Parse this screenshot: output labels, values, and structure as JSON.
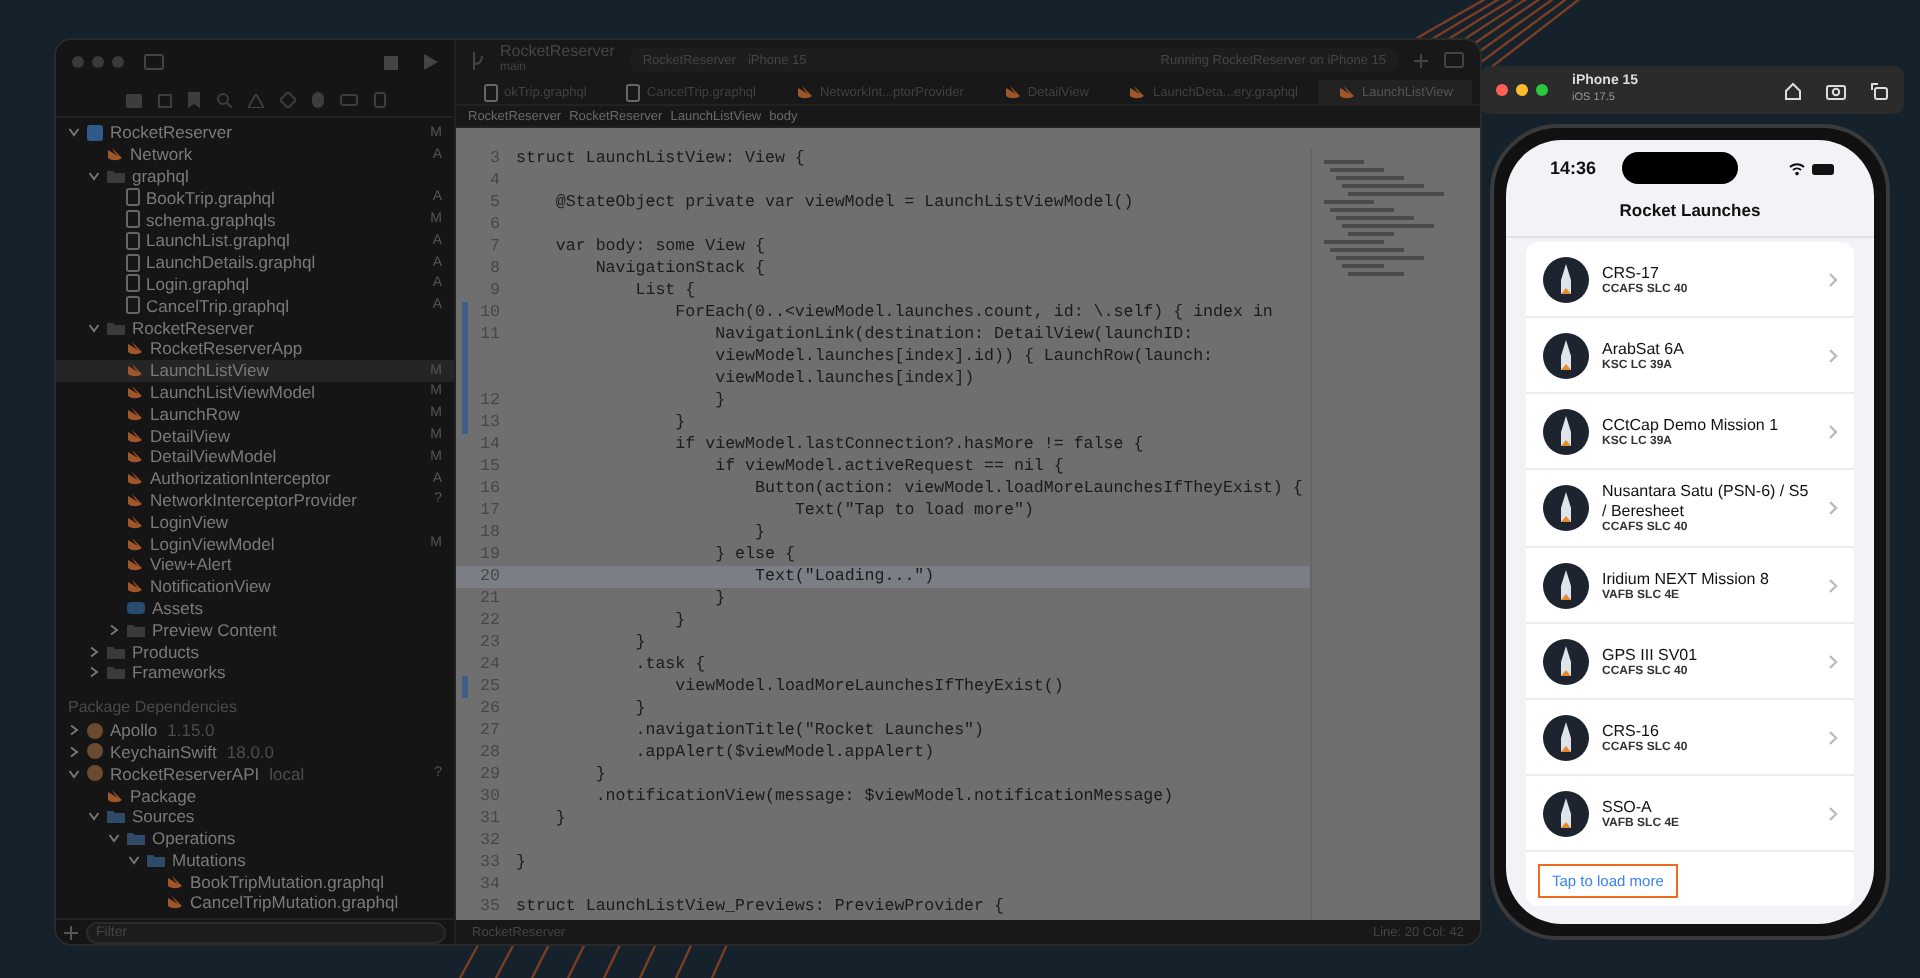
{
  "xcode": {
    "navigator": {
      "tree": [
        {
          "label": "RocketReserver",
          "kind": "project",
          "badge": "M",
          "selected": false,
          "expanded": true,
          "children": [
            {
              "label": "Network",
              "kind": "swift",
              "badge": "A",
              "selected": false
            },
            {
              "label": "graphql",
              "kind": "folder",
              "selected": false,
              "expanded": true,
              "children": [
                {
                  "label": "BookTrip.graphql",
                  "kind": "file",
                  "badge": "A",
                  "selected": false
                },
                {
                  "label": "schema.graphqls",
                  "kind": "file",
                  "badge": "M",
                  "selected": false
                },
                {
                  "label": "LaunchList.graphql",
                  "kind": "file",
                  "badge": "A",
                  "selected": false
                },
                {
                  "label": "LaunchDetails.graphql",
                  "kind": "file",
                  "badge": "A",
                  "selected": false
                },
                {
                  "label": "Login.graphql",
                  "kind": "file",
                  "badge": "A",
                  "selected": false
                },
                {
                  "label": "CancelTrip.graphql",
                  "kind": "file",
                  "badge": "A",
                  "selected": false
                }
              ]
            },
            {
              "label": "RocketReserver",
              "kind": "folder",
              "selected": false,
              "expanded": true,
              "children": [
                {
                  "label": "RocketReserverApp",
                  "kind": "swift",
                  "selected": false
                },
                {
                  "label": "LaunchListView",
                  "kind": "swift",
                  "badge": "M",
                  "selected": true
                },
                {
                  "label": "LaunchListViewModel",
                  "kind": "swift",
                  "badge": "M",
                  "selected": false
                },
                {
                  "label": "LaunchRow",
                  "kind": "swift",
                  "badge": "M",
                  "selected": false
                },
                {
                  "label": "DetailView",
                  "kind": "swift",
                  "badge": "M",
                  "selected": false
                },
                {
                  "label": "DetailViewModel",
                  "kind": "swift",
                  "badge": "M",
                  "selected": false
                },
                {
                  "label": "AuthorizationInterceptor",
                  "kind": "swift",
                  "badge": "A",
                  "selected": false
                },
                {
                  "label": "NetworkInterceptorProvider",
                  "kind": "swift",
                  "badge": "?",
                  "selected": false
                },
                {
                  "label": "LoginView",
                  "kind": "swift",
                  "selected": false
                },
                {
                  "label": "LoginViewModel",
                  "kind": "swift",
                  "badge": "M",
                  "selected": false
                },
                {
                  "label": "View+Alert",
                  "kind": "swift",
                  "selected": false
                },
                {
                  "label": "NotificationView",
                  "kind": "swift",
                  "selected": false
                },
                {
                  "label": "Assets",
                  "kind": "assets",
                  "selected": false
                },
                {
                  "label": "Preview Content",
                  "kind": "folder",
                  "selected": false,
                  "expanded": false
                }
              ]
            },
            {
              "label": "Products",
              "kind": "folder",
              "selected": false,
              "expanded": false
            },
            {
              "label": "Frameworks",
              "kind": "folder",
              "selected": false,
              "expanded": false
            }
          ]
        }
      ],
      "packages_header": "Package Dependencies",
      "packages": [
        {
          "label": "Apollo",
          "kind": "package",
          "version": "1.15.0",
          "selected": false,
          "expanded": false
        },
        {
          "label": "KeychainSwift",
          "kind": "package",
          "version": "18.0.0",
          "selected": false,
          "expanded": false
        },
        {
          "label": "RocketReserverAPI",
          "kind": "package",
          "version": "local",
          "badge": "?",
          "selected": false,
          "expanded": true,
          "children": [
            {
              "label": "Package",
              "kind": "swift",
              "selected": false
            },
            {
              "label": "Sources",
              "kind": "blue-folder",
              "selected": false,
              "expanded": true,
              "children": [
                {
                  "label": "Operations",
                  "kind": "blue-folder",
                  "selected": false,
                  "expanded": true,
                  "children": [
                    {
                      "label": "Mutations",
                      "kind": "blue-folder",
                      "selected": false,
                      "expanded": true,
                      "children": [
                        {
                          "label": "BookTripMutation.graphql",
                          "kind": "swift",
                          "selected": false
                        },
                        {
                          "label": "CancelTripMutation.graphql",
                          "kind": "swift",
                          "selected": false
                        }
                      ]
                    }
                  ]
                }
              ]
            }
          ]
        }
      ],
      "filter": {
        "placeholder": "Filter"
      }
    },
    "toolbar": {
      "project": "RocketReserver",
      "branch": "main",
      "scheme": "RocketReserver",
      "device": "iPhone 15",
      "status": "Running RocketReserver on iPhone 15"
    },
    "tabs": [
      {
        "label": "okTrip.graphql",
        "kind": "file",
        "selected": false
      },
      {
        "label": "CancelTrip.graphql",
        "kind": "file",
        "selected": false
      },
      {
        "label": "NetworkInt...ptorProvider",
        "kind": "swift",
        "selected": false
      },
      {
        "label": "DetailView",
        "kind": "swift",
        "selected": false
      },
      {
        "label": "LaunchDeta...ery.graphql",
        "kind": "swift",
        "selected": false
      },
      {
        "label": "LaunchListView",
        "kind": "swift",
        "selected": true
      }
    ],
    "breadcrumb": [
      "RocketReserver",
      "RocketReserver",
      "LaunchListView",
      "body"
    ],
    "code": [
      {
        "n": "3",
        "text": "struct LaunchListView: View {",
        "highlighted": false,
        "changed": false
      },
      {
        "n": "4",
        "highlighted": false,
        "changed": false
      },
      {
        "n": "5",
        "text": "    @StateObject private var viewModel = LaunchListViewModel()",
        "highlighted": false,
        "changed": false
      },
      {
        "n": "6",
        "highlighted": false,
        "changed": false
      },
      {
        "n": "7",
        "text": "    var body: some View {",
        "highlighted": false,
        "changed": false
      },
      {
        "n": "8",
        "text": "        NavigationStack {",
        "highlighted": false,
        "changed": false
      },
      {
        "n": "9",
        "text": "            List {",
        "highlighted": false,
        "changed": false
      },
      {
        "n": "10",
        "text": "                ForEach(0..<viewModel.launches.count, id: \\.self) { index in",
        "highlighted": false,
        "changed": true
      },
      {
        "n": "11",
        "text": "                    NavigationLink(destination: DetailView(launchID:",
        "wrapped": [
          "viewModel.launches[index].id)) { LaunchRow(launch:",
          "viewModel.launches[index])"
        ],
        "highlighted": false,
        "changed": true
      },
      {
        "n": "12",
        "text": "                    }",
        "highlighted": false,
        "changed": true
      },
      {
        "n": "13",
        "text": "                }",
        "highlighted": false,
        "changed": true
      },
      {
        "n": "14",
        "text": "                if viewModel.lastConnection?.hasMore != false {",
        "highlighted": false,
        "changed": false
      },
      {
        "n": "15",
        "text": "                    if viewModel.activeRequest == nil {",
        "highlighted": false,
        "changed": false
      },
      {
        "n": "16",
        "text": "                        Button(action: viewModel.loadMoreLaunchesIfTheyExist) {",
        "highlighted": false,
        "changed": false
      },
      {
        "n": "17",
        "text": "                            Text(\"Tap to load more\")",
        "highlighted": false,
        "changed": false
      },
      {
        "n": "18",
        "text": "                        }",
        "highlighted": false,
        "changed": false
      },
      {
        "n": "19",
        "text": "                    } else {",
        "highlighted": false,
        "changed": false
      },
      {
        "n": "20",
        "text": "                        Text(\"Loading...\")",
        "highlighted": true,
        "changed": false
      },
      {
        "n": "21",
        "text": "                    }",
        "highlighted": false,
        "changed": false
      },
      {
        "n": "22",
        "text": "                }",
        "highlighted": false,
        "changed": false
      },
      {
        "n": "23",
        "text": "            }",
        "highlighted": false,
        "changed": false
      },
      {
        "n": "24",
        "text": "            .task {",
        "highlighted": false,
        "changed": false
      },
      {
        "n": "25",
        "text": "                viewModel.loadMoreLaunchesIfTheyExist()",
        "highlighted": false,
        "changed": true
      },
      {
        "n": "26",
        "text": "            }",
        "highlighted": false,
        "changed": false
      },
      {
        "n": "27",
        "text": "            .navigationTitle(\"Rocket Launches\")",
        "highlighted": false,
        "changed": false
      },
      {
        "n": "28",
        "text": "            .appAlert($viewModel.appAlert)",
        "highlighted": false,
        "changed": false
      },
      {
        "n": "29",
        "text": "        }",
        "highlighted": false,
        "changed": false
      },
      {
        "n": "30",
        "text": "        .notificationView(message: $viewModel.notificationMessage)",
        "highlighted": false,
        "changed": false
      },
      {
        "n": "31",
        "text": "    }",
        "highlighted": false,
        "changed": false
      },
      {
        "n": "32",
        "highlighted": false,
        "changed": false
      },
      {
        "n": "33",
        "text": "}",
        "highlighted": false,
        "changed": false
      },
      {
        "n": "34",
        "highlighted": false,
        "changed": false
      },
      {
        "n": "35",
        "text": "struct LaunchListView_Previews: PreviewProvider {",
        "highlighted": false,
        "changed": false
      }
    ],
    "status_bar": {
      "target": "RocketReserver",
      "position": "Line: 20  Col: 42"
    }
  },
  "simulator": {
    "device": "iPhone 15",
    "os": "iOS 17.5",
    "time": "14:36",
    "title": "Rocket Launches",
    "launches": [
      {
        "mission": "CRS-17",
        "site": "CCAFS SLC 40"
      },
      {
        "mission": "ArabSat 6A",
        "site": "KSC LC 39A"
      },
      {
        "mission": "CCtCap Demo Mission 1",
        "site": "KSC LC 39A"
      },
      {
        "mission": "Nusantara Satu (PSN-6) / S5 / Beresheet",
        "site": "CCAFS SLC 40"
      },
      {
        "mission": "Iridium NEXT Mission 8",
        "site": "VAFB SLC 4E"
      },
      {
        "mission": "GPS III SV01",
        "site": "CCAFS SLC 40"
      },
      {
        "mission": "CRS-16",
        "site": "CCAFS SLC 40"
      },
      {
        "mission": "SSO-A",
        "site": "VAFB SLC 4E"
      }
    ],
    "load_more": "Tap to load more"
  }
}
